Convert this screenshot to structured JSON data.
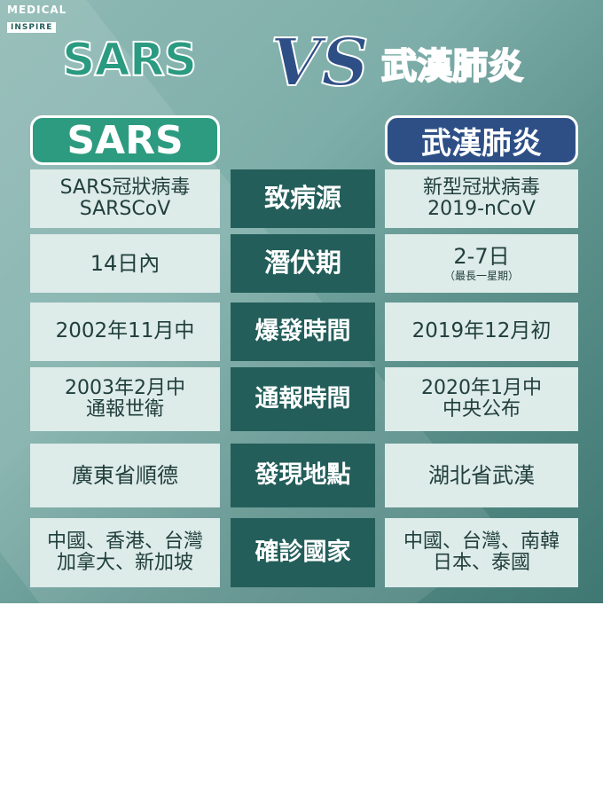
{
  "brand": {
    "line1": "MEDICAL",
    "line2": "INSPIRE"
  },
  "header": {
    "left": "SARS",
    "vs": "VS",
    "right": "武漢肺炎"
  },
  "columns": {
    "left": "SARS",
    "right": "武漢肺炎"
  },
  "rows": [
    {
      "label": "致病源",
      "left": [
        "SARS冠狀病毒",
        "SARSCoV"
      ],
      "right": [
        "新型冠狀病毒",
        "2019-nCoV"
      ]
    },
    {
      "label": "潛伏期",
      "left": [
        "14日內"
      ],
      "right": [
        "2-7日"
      ],
      "right_sub": "（最長一星期）"
    },
    {
      "label": "爆發時間",
      "left": [
        "2002年11月中"
      ],
      "right": [
        "2019年12月初"
      ]
    },
    {
      "label": "通報時間",
      "left": [
        "2003年2月中",
        "通報世衛"
      ],
      "right": [
        "2020年1月中",
        "中央公布"
      ]
    },
    {
      "label": "發現地點",
      "left": [
        "廣東省順德"
      ],
      "right": [
        "湖北省武漢"
      ]
    },
    {
      "label": "確診國家",
      "left": [
        "中國、香港、台灣",
        "加拿大、新加坡"
      ],
      "right": [
        "中國、台灣、南韓",
        "日本、泰國"
      ]
    }
  ],
  "colors": {
    "bg_light": "#8fb9b4",
    "bg_dark": "#3f7772",
    "sars_green": "#2d9b80",
    "wuhan_blue": "#2e4f86",
    "center_dark": "#235e5a",
    "cell_light": "#ddebe9"
  }
}
